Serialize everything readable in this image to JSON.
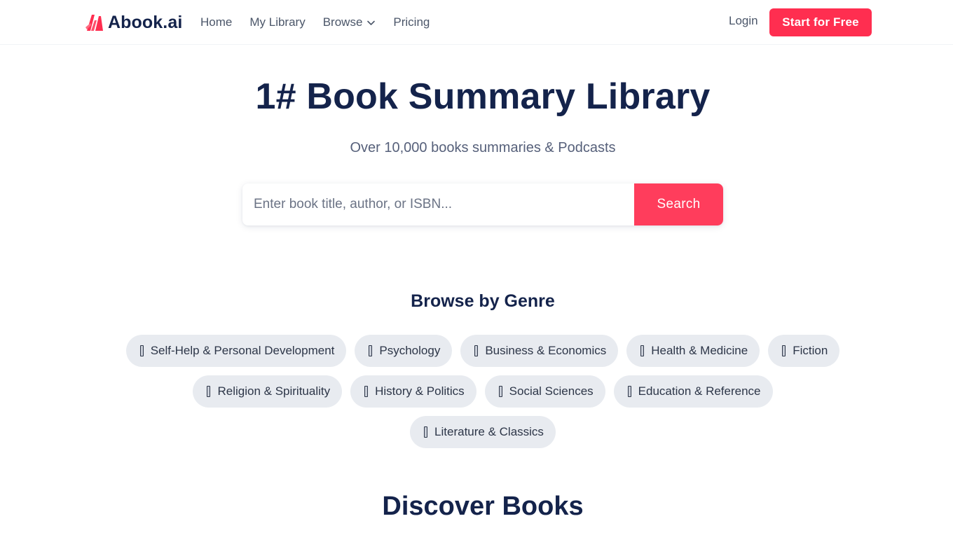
{
  "brand": {
    "name": "Abook.ai",
    "logo_icon": "abook-logo-icon",
    "accent_color": "#ff2e50"
  },
  "nav": {
    "items": [
      {
        "label": "Home"
      },
      {
        "label": "My Library"
      },
      {
        "label": "Browse",
        "has_dropdown": true,
        "icon": "chevron-down-icon"
      },
      {
        "label": "Pricing"
      }
    ],
    "login_label": "Login",
    "cta_label": "Start for Free"
  },
  "hero": {
    "title": "1# Book Summary Library",
    "subtitle": "Over 10,000 books summaries & Podcasts",
    "search": {
      "placeholder": "Enter book title, author, or ISBN...",
      "value": "",
      "button_label": "Search"
    }
  },
  "genres": {
    "title": "Browse by Genre",
    "items": [
      {
        "label": "Self-Help & Personal Development"
      },
      {
        "label": "Psychology"
      },
      {
        "label": "Business & Economics"
      },
      {
        "label": "Health & Medicine"
      },
      {
        "label": "Fiction"
      },
      {
        "label": "Religion & Spirituality"
      },
      {
        "label": "History & Politics"
      },
      {
        "label": "Social Sciences"
      },
      {
        "label": "Education & Reference"
      },
      {
        "label": "Literature & Classics"
      }
    ],
    "chip_icon": "book-icon"
  },
  "discover": {
    "title": "Discover Books"
  }
}
